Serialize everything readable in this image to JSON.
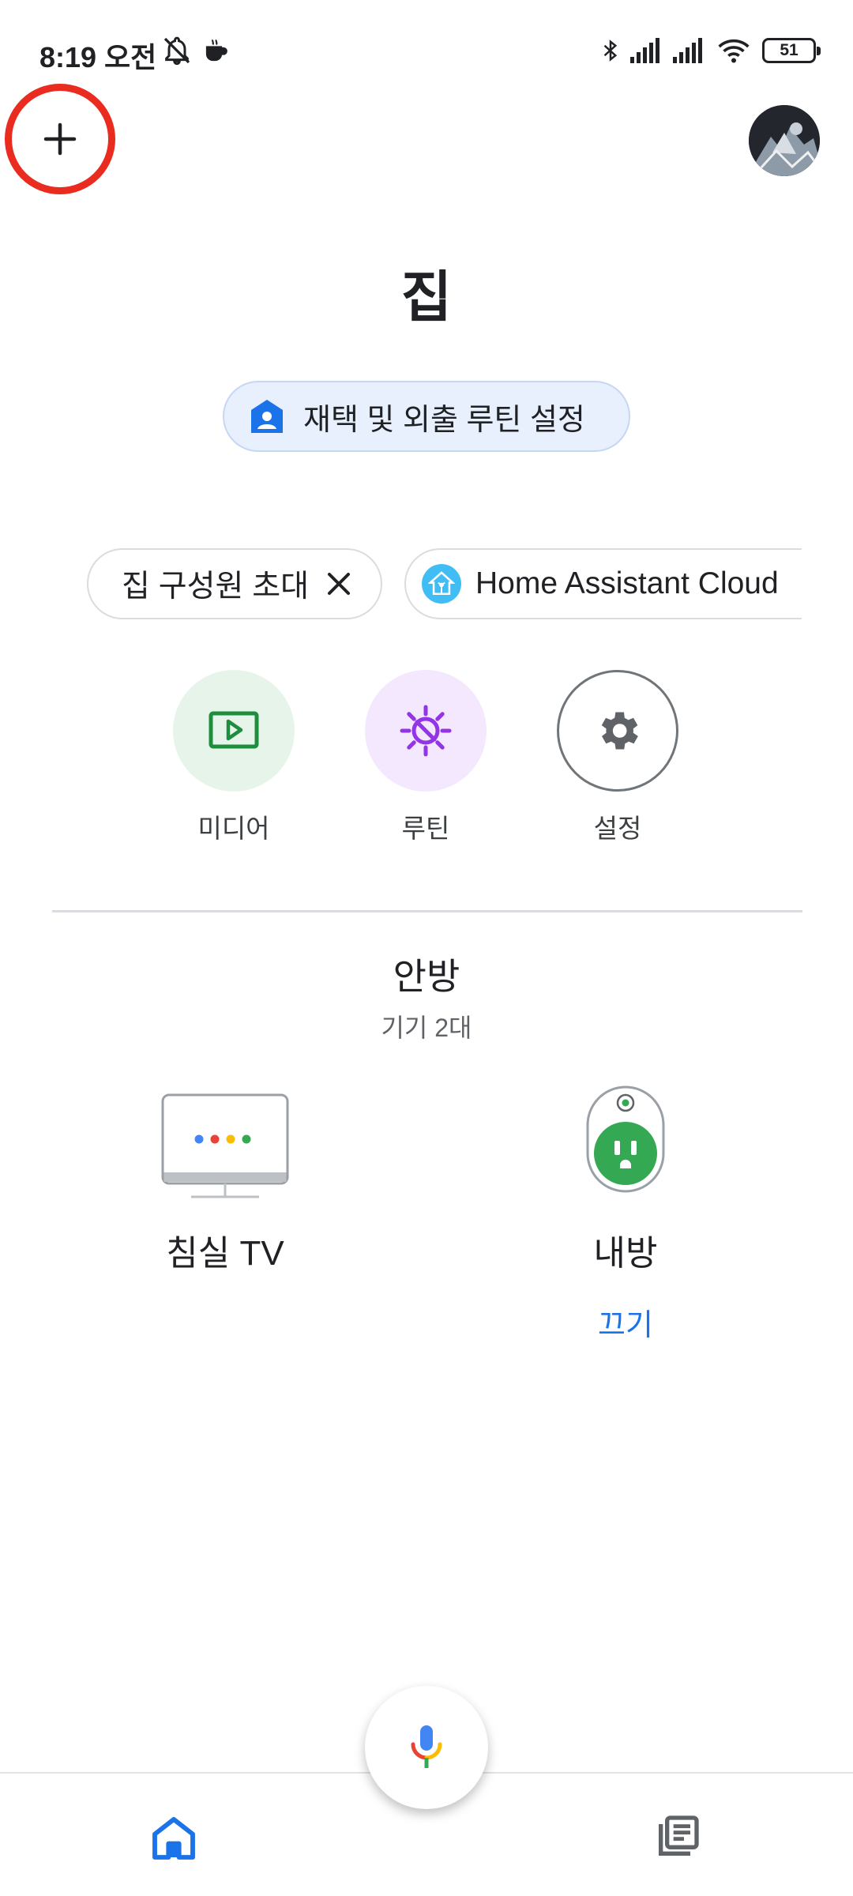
{
  "status_bar": {
    "time": "8:19 오전",
    "battery": "51"
  },
  "header": {
    "title": "집"
  },
  "routine_chip": {
    "label": "재택 및 외출 루틴 설정"
  },
  "chips": [
    {
      "label": "집 구성원 초대"
    },
    {
      "label": "Home Assistant Cloud"
    }
  ],
  "shortcuts": [
    {
      "label": "미디어",
      "color": "#1e8e3e",
      "bg": "#e6f4ea"
    },
    {
      "label": "루틴",
      "color": "#9334e6",
      "bg": "#f3e8fd"
    },
    {
      "label": "설정",
      "color": "#5f6368",
      "bg": "#ffffff"
    }
  ],
  "room": {
    "name": "안방",
    "device_count": "기기 2대"
  },
  "devices": [
    {
      "name": "침실 TV"
    },
    {
      "name": "내방",
      "action": "끄기"
    }
  ],
  "colors": {
    "accent": "#1a73e8",
    "highlight_ring": "#ea2b1f"
  }
}
